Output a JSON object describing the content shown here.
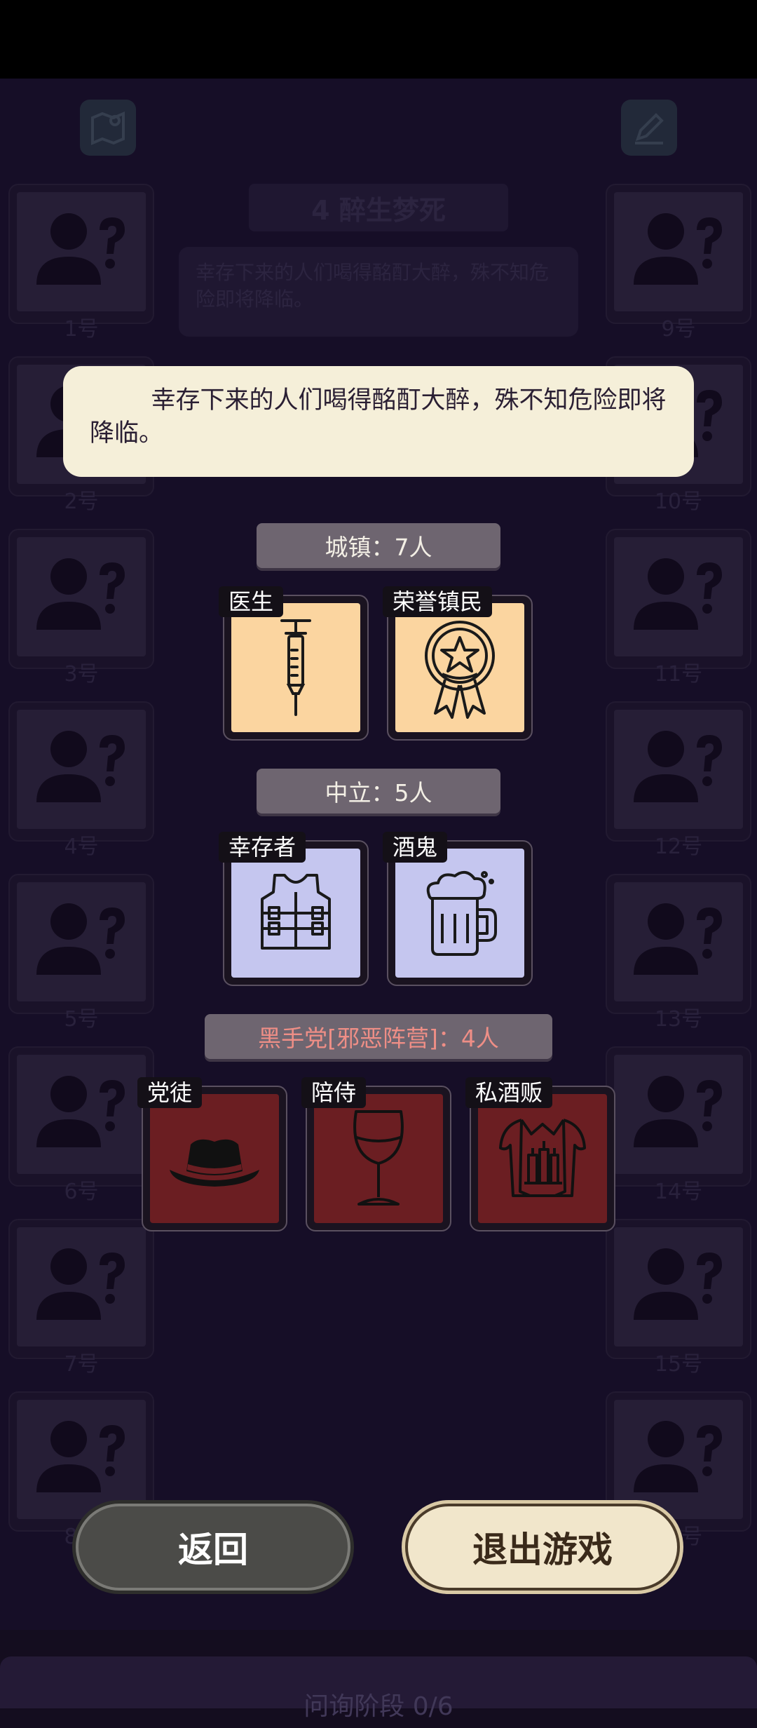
{
  "background": {
    "chapter_title": "4  醉生梦死",
    "chapter_desc": "幸存下来的人们喝得酩酊大醉，殊不知危险即将降临。",
    "seats_left": [
      "1号",
      "2号",
      "3号",
      "4号",
      "5号",
      "6号",
      "7号",
      "8号"
    ],
    "seats_right": [
      "9号",
      "10号",
      "11号",
      "12号",
      "13号",
      "14号",
      "15号",
      "16号"
    ],
    "phase_text": "问询阶段 0/6"
  },
  "story_text": "幸存下来的人们喝得酩酊大醉，殊不知危险即将降临。",
  "factions": {
    "town": {
      "label": "城镇：7人",
      "roles": [
        "医生",
        "荣誉镇民"
      ]
    },
    "neutral": {
      "label": "中立：5人",
      "roles": [
        "幸存者",
        "酒鬼"
      ]
    },
    "evil": {
      "label": "黑手党[邪恶阵营]：4人",
      "roles": [
        "党徒",
        "陪侍",
        "私酒贩"
      ]
    }
  },
  "buttons": {
    "back": "返回",
    "exit": "退出游戏"
  },
  "colors": {
    "town_card": "#fbd5a0",
    "neutral_card": "#c5c6ef",
    "evil_card": "#6b1e22",
    "evil_text": "#ee8e86"
  },
  "icons": {
    "map": "map-icon",
    "edit": "edit-icon",
    "doctor": "syringe-icon",
    "honored": "medal-icon",
    "survivor": "vest-icon",
    "drunk": "beer-mug-icon",
    "thug": "fedora-hat-icon",
    "escort": "wine-glass-icon",
    "bootlegger": "coat-bottles-icon"
  }
}
